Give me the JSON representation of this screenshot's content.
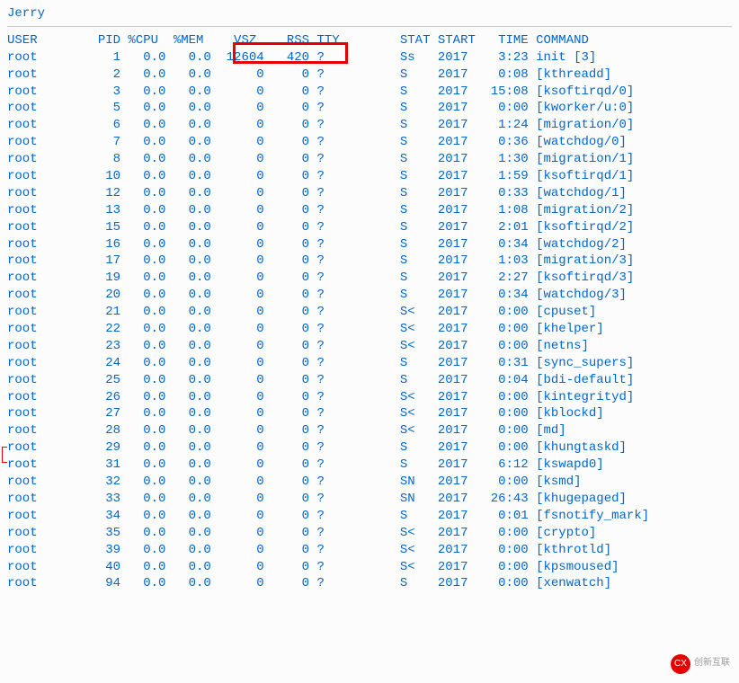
{
  "prompt": "Jerry",
  "headers": {
    "user": "USER",
    "pid": "PID",
    "cpu": "%CPU",
    "mem": "%MEM",
    "vsz": "VSZ",
    "rss": "RSS",
    "tty": "TTY",
    "stat": "STAT",
    "start": "START",
    "time": "TIME",
    "command": "COMMAND"
  },
  "rows": [
    {
      "user": "root",
      "pid": "1",
      "cpu": "0.0",
      "mem": "0.0",
      "vsz": "12604",
      "rss": "420",
      "tty": "?",
      "stat": "Ss",
      "start": "2017",
      "time": "3:23",
      "command": "init [3]"
    },
    {
      "user": "root",
      "pid": "2",
      "cpu": "0.0",
      "mem": "0.0",
      "vsz": "0",
      "rss": "0",
      "tty": "?",
      "stat": "S",
      "start": "2017",
      "time": "0:08",
      "command": "[kthreadd]"
    },
    {
      "user": "root",
      "pid": "3",
      "cpu": "0.0",
      "mem": "0.0",
      "vsz": "0",
      "rss": "0",
      "tty": "?",
      "stat": "S",
      "start": "2017",
      "time": "15:08",
      "command": "[ksoftirqd/0]"
    },
    {
      "user": "root",
      "pid": "5",
      "cpu": "0.0",
      "mem": "0.0",
      "vsz": "0",
      "rss": "0",
      "tty": "?",
      "stat": "S",
      "start": "2017",
      "time": "0:00",
      "command": "[kworker/u:0]"
    },
    {
      "user": "root",
      "pid": "6",
      "cpu": "0.0",
      "mem": "0.0",
      "vsz": "0",
      "rss": "0",
      "tty": "?",
      "stat": "S",
      "start": "2017",
      "time": "1:24",
      "command": "[migration/0]"
    },
    {
      "user": "root",
      "pid": "7",
      "cpu": "0.0",
      "mem": "0.0",
      "vsz": "0",
      "rss": "0",
      "tty": "?",
      "stat": "S",
      "start": "2017",
      "time": "0:36",
      "command": "[watchdog/0]"
    },
    {
      "user": "root",
      "pid": "8",
      "cpu": "0.0",
      "mem": "0.0",
      "vsz": "0",
      "rss": "0",
      "tty": "?",
      "stat": "S",
      "start": "2017",
      "time": "1:30",
      "command": "[migration/1]"
    },
    {
      "user": "root",
      "pid": "10",
      "cpu": "0.0",
      "mem": "0.0",
      "vsz": "0",
      "rss": "0",
      "tty": "?",
      "stat": "S",
      "start": "2017",
      "time": "1:59",
      "command": "[ksoftirqd/1]"
    },
    {
      "user": "root",
      "pid": "12",
      "cpu": "0.0",
      "mem": "0.0",
      "vsz": "0",
      "rss": "0",
      "tty": "?",
      "stat": "S",
      "start": "2017",
      "time": "0:33",
      "command": "[watchdog/1]"
    },
    {
      "user": "root",
      "pid": "13",
      "cpu": "0.0",
      "mem": "0.0",
      "vsz": "0",
      "rss": "0",
      "tty": "?",
      "stat": "S",
      "start": "2017",
      "time": "1:08",
      "command": "[migration/2]"
    },
    {
      "user": "root",
      "pid": "15",
      "cpu": "0.0",
      "mem": "0.0",
      "vsz": "0",
      "rss": "0",
      "tty": "?",
      "stat": "S",
      "start": "2017",
      "time": "2:01",
      "command": "[ksoftirqd/2]"
    },
    {
      "user": "root",
      "pid": "16",
      "cpu": "0.0",
      "mem": "0.0",
      "vsz": "0",
      "rss": "0",
      "tty": "?",
      "stat": "S",
      "start": "2017",
      "time": "0:34",
      "command": "[watchdog/2]"
    },
    {
      "user": "root",
      "pid": "17",
      "cpu": "0.0",
      "mem": "0.0",
      "vsz": "0",
      "rss": "0",
      "tty": "?",
      "stat": "S",
      "start": "2017",
      "time": "1:03",
      "command": "[migration/3]"
    },
    {
      "user": "root",
      "pid": "19",
      "cpu": "0.0",
      "mem": "0.0",
      "vsz": "0",
      "rss": "0",
      "tty": "?",
      "stat": "S",
      "start": "2017",
      "time": "2:27",
      "command": "[ksoftirqd/3]"
    },
    {
      "user": "root",
      "pid": "20",
      "cpu": "0.0",
      "mem": "0.0",
      "vsz": "0",
      "rss": "0",
      "tty": "?",
      "stat": "S",
      "start": "2017",
      "time": "0:34",
      "command": "[watchdog/3]"
    },
    {
      "user": "root",
      "pid": "21",
      "cpu": "0.0",
      "mem": "0.0",
      "vsz": "0",
      "rss": "0",
      "tty": "?",
      "stat": "S<",
      "start": "2017",
      "time": "0:00",
      "command": "[cpuset]"
    },
    {
      "user": "root",
      "pid": "22",
      "cpu": "0.0",
      "mem": "0.0",
      "vsz": "0",
      "rss": "0",
      "tty": "?",
      "stat": "S<",
      "start": "2017",
      "time": "0:00",
      "command": "[khelper]"
    },
    {
      "user": "root",
      "pid": "23",
      "cpu": "0.0",
      "mem": "0.0",
      "vsz": "0",
      "rss": "0",
      "tty": "?",
      "stat": "S<",
      "start": "2017",
      "time": "0:00",
      "command": "[netns]"
    },
    {
      "user": "root",
      "pid": "24",
      "cpu": "0.0",
      "mem": "0.0",
      "vsz": "0",
      "rss": "0",
      "tty": "?",
      "stat": "S",
      "start": "2017",
      "time": "0:31",
      "command": "[sync_supers]"
    },
    {
      "user": "root",
      "pid": "25",
      "cpu": "0.0",
      "mem": "0.0",
      "vsz": "0",
      "rss": "0",
      "tty": "?",
      "stat": "S",
      "start": "2017",
      "time": "0:04",
      "command": "[bdi-default]"
    },
    {
      "user": "root",
      "pid": "26",
      "cpu": "0.0",
      "mem": "0.0",
      "vsz": "0",
      "rss": "0",
      "tty": "?",
      "stat": "S<",
      "start": "2017",
      "time": "0:00",
      "command": "[kintegrityd]"
    },
    {
      "user": "root",
      "pid": "27",
      "cpu": "0.0",
      "mem": "0.0",
      "vsz": "0",
      "rss": "0",
      "tty": "?",
      "stat": "S<",
      "start": "2017",
      "time": "0:00",
      "command": "[kblockd]"
    },
    {
      "user": "root",
      "pid": "28",
      "cpu": "0.0",
      "mem": "0.0",
      "vsz": "0",
      "rss": "0",
      "tty": "?",
      "stat": "S<",
      "start": "2017",
      "time": "0:00",
      "command": "[md]"
    },
    {
      "user": "root",
      "pid": "29",
      "cpu": "0.0",
      "mem": "0.0",
      "vsz": "0",
      "rss": "0",
      "tty": "?",
      "stat": "S",
      "start": "2017",
      "time": "0:00",
      "command": "[khungtaskd]"
    },
    {
      "user": "root",
      "pid": "31",
      "cpu": "0.0",
      "mem": "0.0",
      "vsz": "0",
      "rss": "0",
      "tty": "?",
      "stat": "S",
      "start": "2017",
      "time": "6:12",
      "command": "[kswapd0]"
    },
    {
      "user": "root",
      "pid": "32",
      "cpu": "0.0",
      "mem": "0.0",
      "vsz": "0",
      "rss": "0",
      "tty": "?",
      "stat": "SN",
      "start": "2017",
      "time": "0:00",
      "command": "[ksmd]"
    },
    {
      "user": "root",
      "pid": "33",
      "cpu": "0.0",
      "mem": "0.0",
      "vsz": "0",
      "rss": "0",
      "tty": "?",
      "stat": "SN",
      "start": "2017",
      "time": "26:43",
      "command": "[khugepaged]"
    },
    {
      "user": "root",
      "pid": "34",
      "cpu": "0.0",
      "mem": "0.0",
      "vsz": "0",
      "rss": "0",
      "tty": "?",
      "stat": "S",
      "start": "2017",
      "time": "0:01",
      "command": "[fsnotify_mark]"
    },
    {
      "user": "root",
      "pid": "35",
      "cpu": "0.0",
      "mem": "0.0",
      "vsz": "0",
      "rss": "0",
      "tty": "?",
      "stat": "S<",
      "start": "2017",
      "time": "0:00",
      "command": "[crypto]"
    },
    {
      "user": "root",
      "pid": "39",
      "cpu": "0.0",
      "mem": "0.0",
      "vsz": "0",
      "rss": "0",
      "tty": "?",
      "stat": "S<",
      "start": "2017",
      "time": "0:00",
      "command": "[kthrotld]"
    },
    {
      "user": "root",
      "pid": "40",
      "cpu": "0.0",
      "mem": "0.0",
      "vsz": "0",
      "rss": "0",
      "tty": "?",
      "stat": "S<",
      "start": "2017",
      "time": "0:00",
      "command": "[kpsmoused]"
    },
    {
      "user": "root",
      "pid": "94",
      "cpu": "0.0",
      "mem": "0.0",
      "vsz": "0",
      "rss": "0",
      "tty": "?",
      "stat": "S",
      "start": "2017",
      "time": "0:00",
      "command": "[xenwatch]"
    }
  ],
  "watermark": {
    "logo": "CX",
    "text": "创新互联"
  },
  "highlight_columns": [
    "vsz",
    "rss"
  ]
}
